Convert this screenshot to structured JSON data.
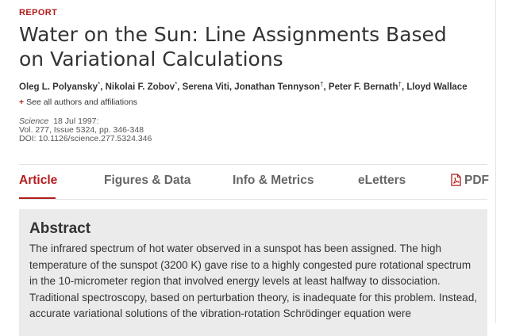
{
  "article_type": "REPORT",
  "title": "Water on the Sun: Line Assignments Based on Variational Calculations",
  "authors": [
    {
      "name": "Oleg L. Polyansky",
      "mark": "*"
    },
    {
      "name": "Nikolai F. Zobov",
      "mark": "*"
    },
    {
      "name": "Serena Viti",
      "mark": ""
    },
    {
      "name": "Jonathan Tennyson",
      "mark": "†"
    },
    {
      "name": "Peter F. Bernath",
      "mark": "†"
    },
    {
      "name": "Lloyd Wallace",
      "mark": ""
    }
  ],
  "authors_separator": ", ",
  "see_all_label": "See all authors and affiliations",
  "citation": {
    "journal": "Science",
    "date": "18 Jul 1997:",
    "volume_line": "Vol. 277, Issue 5324, pp. 346-348",
    "doi_line": "DOI: 10.1126/science.277.5324.346"
  },
  "tabs": [
    {
      "label": "Article",
      "active": true
    },
    {
      "label": "Figures & Data",
      "active": false
    },
    {
      "label": "Info & Metrics",
      "active": false
    },
    {
      "label": "eLetters",
      "active": false
    },
    {
      "label": "PDF",
      "active": false,
      "icon": "pdf-icon"
    }
  ],
  "abstract": {
    "heading": "Abstract",
    "text": "The infrared spectrum of hot water observed in a sunspot has been assigned. The high temperature of the sunspot (3200 K) gave rise to a highly congested pure rotational spectrum in the 10-micrometer region that involved energy levels at least halfway to dissociation. Traditional spectroscopy, based on perturbation theory, is inadequate for this problem. Instead, accurate variational solutions of the vibration-rotation Schrödinger equation were"
  },
  "colors": {
    "accent": "#b31b1b",
    "text": "#333333",
    "abstract_bg": "#ebebeb"
  }
}
